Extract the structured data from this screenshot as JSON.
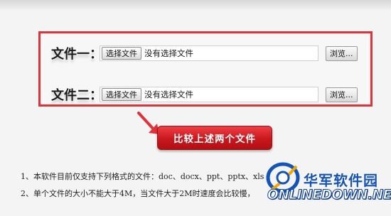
{
  "upload": {
    "file1": {
      "label": "文件一：",
      "choose_label": "选择文件",
      "status": "没有选择文件",
      "browse_label": "浏览..."
    },
    "file2": {
      "label": "文件二：",
      "choose_label": "选择文件",
      "status": "没有选择文件",
      "browse_label": "浏览..."
    }
  },
  "compare_button": {
    "label": "比较上述两个文件"
  },
  "notes": [
    "1、本软件目前仅支持下列格式的文件：doc、docx、ppt、pptx、xls",
    "2、单个文件的大小不能大于4M，当文件大于2M时速度会比较慢，"
  ],
  "watermark": {
    "cn": "华军软件园",
    "en": "ONLINEDOWN.NET"
  },
  "colors": {
    "accent_red": "#e0323a",
    "button_red": "#c8181e",
    "brand_blue": "#1453b8"
  },
  "icons": {
    "arrow": "arrow-pointing-icon",
    "logo": "onlinedown-logo-icon"
  }
}
